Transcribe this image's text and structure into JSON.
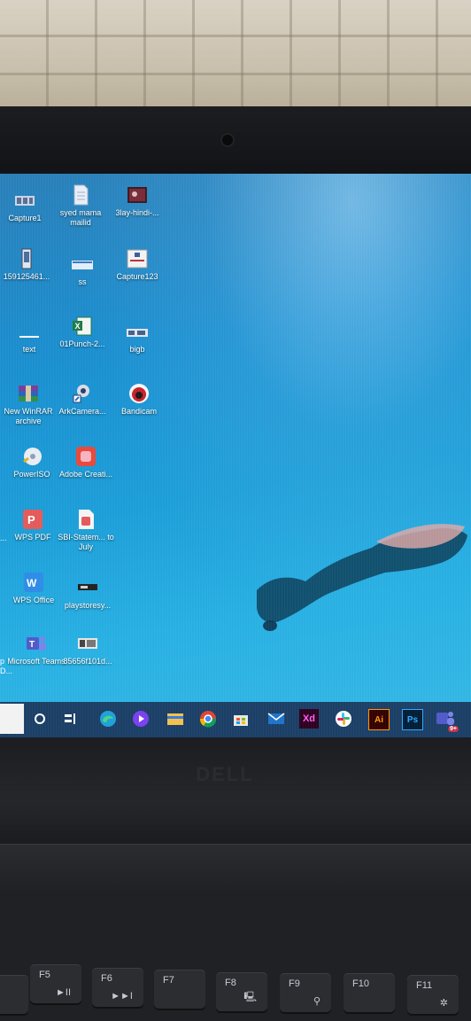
{
  "desktop": {
    "icons": [
      {
        "label": "Capture1",
        "icon": "image-thumbnail-icon",
        "color": "#c9d4e6"
      },
      {
        "label": "syed mama mailid",
        "icon": "text-document-icon",
        "color": "#e8eef7"
      },
      {
        "label": "3lay-hindi-...",
        "icon": "video-thumbnail-icon",
        "color": "#7a2b36"
      },
      {
        "label": "159125461...",
        "icon": "phone-screenshot-icon",
        "color": "#dfe6f0"
      },
      {
        "label": "ss",
        "icon": "image-thumbnail-icon",
        "color": "#e4ecf6"
      },
      {
        "label": "Capture123",
        "icon": "image-thumbnail-icon",
        "color": "#f3f3f3"
      },
      {
        "label": "text",
        "icon": "text-document-icon",
        "color": "#ffffff"
      },
      {
        "label": "01Punch-2...",
        "icon": "excel-file-icon",
        "color": "#1e7a45"
      },
      {
        "label": "bigb",
        "icon": "image-thumbnail-icon",
        "color": "#e0e6ee"
      },
      {
        "label": "New WinRAR archive",
        "icon": "winrar-icon",
        "color": "#7a3d9a"
      },
      {
        "label": "ArkCamera...",
        "icon": "webcam-app-icon",
        "color": "#d7dde6"
      },
      {
        "label": "Bandicam",
        "icon": "bandicam-icon",
        "color": "#c8202a"
      },
      {
        "label": "PowerISO",
        "icon": "disc-icon",
        "color": "#e9ecf2"
      },
      {
        "label": "Adobe Creati...",
        "icon": "adobe-creative-cloud-icon",
        "color": "#e8483a"
      },
      {
        "label": "WPS PDF",
        "icon": "wps-pdf-icon",
        "color": "#e35a5a"
      },
      {
        "label": "SBI-Statem... to July",
        "icon": "pdf-file-icon",
        "color": "#f4f4f4"
      },
      {
        "label": "WPS Office",
        "icon": "wps-office-icon",
        "color": "#2d8ce6"
      },
      {
        "label": "playstoresy...",
        "icon": "image-thumbnail-icon",
        "color": "#222222"
      },
      {
        "label": "Microsoft Teams",
        "icon": "teams-icon",
        "color": "#5059c9"
      },
      {
        "label": "85656f101d...",
        "icon": "image-thumbnail-icon",
        "color": "#e6e6e6"
      }
    ],
    "edge_labels": [
      "...",
      "p",
      "D..."
    ]
  },
  "taskbar": {
    "items": [
      {
        "name": "cortana-icon",
        "glyph": "○"
      },
      {
        "name": "task-view-icon",
        "glyph": "⊟"
      },
      {
        "name": "edge-icon",
        "glyph": ""
      },
      {
        "name": "media-player-icon",
        "glyph": ""
      },
      {
        "name": "file-explorer-icon",
        "glyph": ""
      },
      {
        "name": "chrome-icon",
        "glyph": ""
      },
      {
        "name": "store-icon",
        "glyph": ""
      },
      {
        "name": "mail-icon",
        "glyph": ""
      },
      {
        "name": "adobe-xd-icon",
        "glyph": "Xd"
      },
      {
        "name": "slack-icon",
        "glyph": ""
      },
      {
        "name": "adobe-illustrator-icon",
        "glyph": "Ai"
      },
      {
        "name": "photoshop-icon",
        "glyph": "Ps"
      },
      {
        "name": "teams-icon",
        "glyph": "9+"
      }
    ]
  },
  "hardware": {
    "brand": "DELL",
    "keys": [
      {
        "label": "F5",
        "glyph": "►II"
      },
      {
        "label": "F6",
        "glyph": "►►I"
      },
      {
        "label": "F7",
        "glyph": ""
      },
      {
        "label": "F8",
        "glyph": "🖳"
      },
      {
        "label": "F9",
        "glyph": "⚲"
      },
      {
        "label": "F10",
        "glyph": ""
      },
      {
        "label": "F11",
        "glyph": "✲"
      }
    ]
  }
}
